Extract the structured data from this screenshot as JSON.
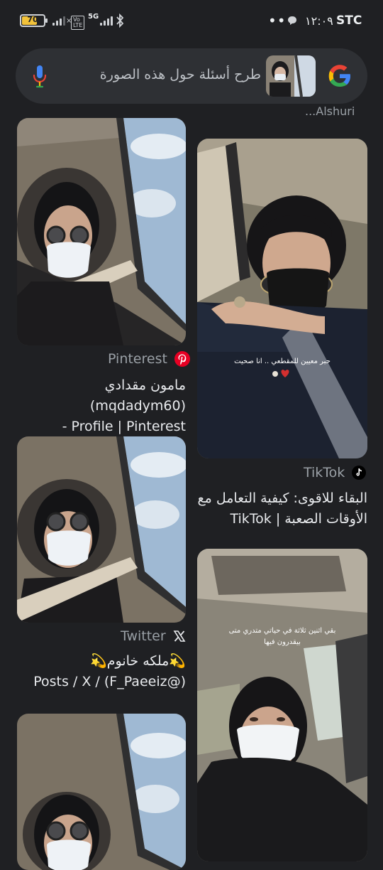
{
  "status_bar": {
    "battery": "70",
    "network": "5G",
    "time": "١٢:٠٩",
    "carrier": "STC"
  },
  "search": {
    "placeholder": "طرح أسئلة حول هذه الصورة"
  },
  "clipped_title": "...Alshuri",
  "results": [
    {
      "source": "Pinterest",
      "title_line1": "مامون مقدادي (mqdadym60)",
      "title_line2": "Profile | Pinterest -"
    },
    {
      "source": "TikTok",
      "title_line1": "البقاء للاقوى: كيفية التعامل مع",
      "title_line2": "الأوقات الصعبة | TikTok"
    },
    {
      "source": "Twitter",
      "title_line1": "💫ملكه خانوم💫",
      "title_line2": "Posts / X / (F_Paeeiz@)"
    }
  ],
  "image_captions": {
    "tiktok_overlay": "حبر معيين للمقطعي .. انا صحيت",
    "right_bottom_overlay_1": "بقي اثنين ثلاثة في حياتي متدري متى",
    "right_bottom_overlay_2": "بيقدرون فيها"
  },
  "colors": {
    "background": "#1f2023",
    "search_bar": "#2e3034",
    "pinterest": "#e60023",
    "battery": "#f2c23a"
  }
}
